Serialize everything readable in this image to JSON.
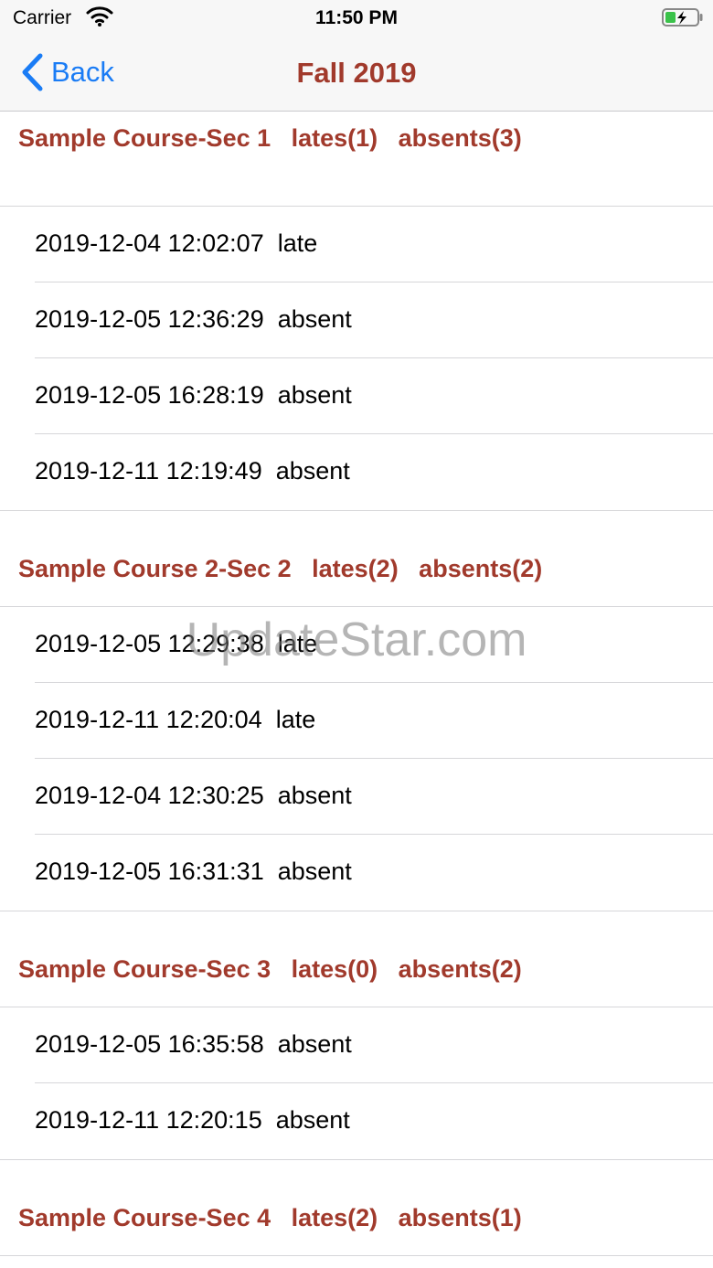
{
  "status_bar": {
    "carrier": "Carrier",
    "time": "11:50 PM"
  },
  "nav": {
    "back_label": "Back",
    "title": "Fall 2019"
  },
  "sections": [
    {
      "header": "Sample Course-Sec 1   lates(1)   absents(3)",
      "rows": [
        "2019-12-04 12:02:07  late",
        "2019-12-05 12:36:29  absent",
        "2019-12-05 16:28:19  absent",
        "2019-12-11 12:19:49  absent"
      ]
    },
    {
      "header": "Sample Course 2-Sec 2   lates(2)   absents(2)",
      "rows": [
        "2019-12-05 12:29:38  late",
        "2019-12-11 12:20:04  late",
        "2019-12-04 12:30:25  absent",
        "2019-12-05 16:31:31  absent"
      ]
    },
    {
      "header": "Sample Course-Sec 3   lates(0)   absents(2)",
      "rows": [
        "2019-12-05 16:35:58  absent",
        "2019-12-11 12:20:15  absent"
      ]
    },
    {
      "header": "Sample Course-Sec 4   lates(2)   absents(1)",
      "rows": []
    }
  ],
  "watermark": "UpdateStar.com",
  "colors": {
    "accent": "#a13a2c",
    "link": "#1a7cf5",
    "separator": "#d6d6d9"
  }
}
